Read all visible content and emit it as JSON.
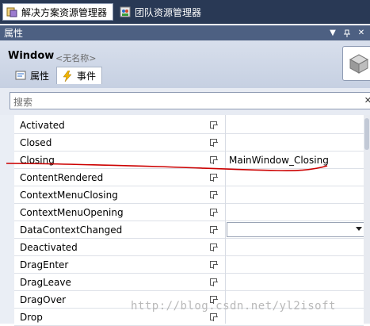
{
  "tabs": [
    {
      "label": "解决方案资源管理器",
      "icon": "solution-explorer-icon",
      "active": true
    },
    {
      "label": "团队资源管理器",
      "icon": "team-explorer-icon",
      "active": false
    }
  ],
  "panel": {
    "title": "属性",
    "pin_icon": "pin-icon",
    "close_icon": "close-icon",
    "dropdown_icon": "dropdown-icon"
  },
  "object": {
    "name": "Window",
    "description": "<无名称>"
  },
  "view_tabs": [
    {
      "label": "属性",
      "icon": "properties-icon"
    },
    {
      "label": "事件",
      "icon": "lightning-icon",
      "selected": true
    }
  ],
  "search": {
    "placeholder": "搜索"
  },
  "events": [
    {
      "name": "Activated",
      "value": ""
    },
    {
      "name": "Closed",
      "value": ""
    },
    {
      "name": "Closing",
      "value": "MainWindow_Closing"
    },
    {
      "name": "ContentRendered",
      "value": ""
    },
    {
      "name": "ContextMenuClosing",
      "value": ""
    },
    {
      "name": "ContextMenuOpening",
      "value": ""
    },
    {
      "name": "DataContextChanged",
      "value": "",
      "has_dropdown": true
    },
    {
      "name": "Deactivated",
      "value": ""
    },
    {
      "name": "DragEnter",
      "value": ""
    },
    {
      "name": "DragLeave",
      "value": ""
    },
    {
      "name": "DragOver",
      "value": ""
    },
    {
      "name": "Drop",
      "value": ""
    }
  ],
  "watermark": "http://blog.csdn.net/yl2isoft",
  "colors": {
    "annotation": "#cc0000",
    "title_bar": "#4d6082",
    "tab_strip": "#293955"
  }
}
